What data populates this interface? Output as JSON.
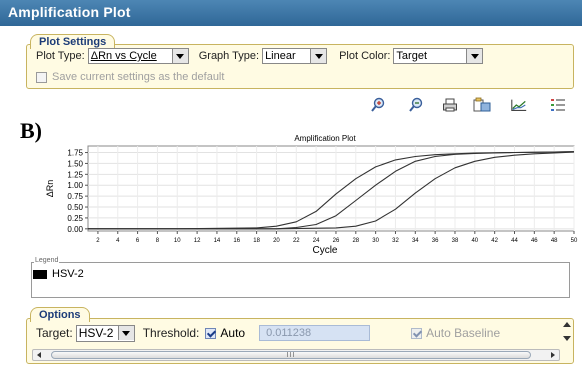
{
  "window": {
    "title": "Amplification Plot"
  },
  "plot_settings": {
    "title": "Plot Settings",
    "plot_type_label": "Plot Type:",
    "plot_type_value": "ΔRn vs Cycle",
    "graph_type_label": "Graph Type:",
    "graph_type_value": "Linear",
    "plot_color_label": "Plot Color:",
    "plot_color_value": "Target",
    "save_default_label": "Save current settings as the default"
  },
  "toolbar": {
    "icons": [
      "zoom-in-icon",
      "zoom-out-icon",
      "print-icon",
      "export-icon",
      "graph-icon",
      "legend-list-icon"
    ]
  },
  "panel_letter": "B)",
  "chart_data": {
    "type": "line",
    "title": "Amplification Plot",
    "xlabel": "Cycle",
    "ylabel": "ΔRn",
    "xlim": [
      1,
      50
    ],
    "ylim": [
      -0.05,
      1.9
    ],
    "xticks": [
      "2",
      "4",
      "6",
      "8",
      "10",
      "12",
      "14",
      "16",
      "18",
      "20",
      "22",
      "24",
      "26",
      "28",
      "30",
      "32",
      "34",
      "36",
      "38",
      "40",
      "42",
      "44",
      "46",
      "48",
      "50"
    ],
    "yticks": [
      "0.00",
      "0.25",
      "0.50",
      "0.75",
      "1.00",
      "1.25",
      "1.50",
      "1.75"
    ],
    "grid": true,
    "series_color": "#333333",
    "series": [
      {
        "x": [
          1,
          10,
          18,
          20,
          22,
          24,
          26,
          28,
          30,
          32,
          34,
          36,
          38,
          40,
          44,
          48,
          50
        ],
        "y": [
          0.0,
          0.0,
          0.02,
          0.06,
          0.16,
          0.4,
          0.8,
          1.15,
          1.42,
          1.58,
          1.66,
          1.7,
          1.72,
          1.74,
          1.75,
          1.76,
          1.77
        ]
      },
      {
        "x": [
          1,
          10,
          20,
          22,
          24,
          26,
          28,
          30,
          32,
          34,
          36,
          38,
          40,
          44,
          48,
          50
        ],
        "y": [
          0.0,
          0.0,
          0.0,
          0.03,
          0.1,
          0.3,
          0.65,
          1.0,
          1.32,
          1.55,
          1.66,
          1.71,
          1.73,
          1.75,
          1.76,
          1.77
        ]
      },
      {
        "x": [
          1,
          10,
          20,
          26,
          28,
          30,
          32,
          34,
          36,
          38,
          40,
          42,
          44,
          46,
          48,
          50
        ],
        "y": [
          0.0,
          0.0,
          0.0,
          0.02,
          0.06,
          0.18,
          0.45,
          0.82,
          1.15,
          1.4,
          1.55,
          1.64,
          1.69,
          1.72,
          1.74,
          1.76
        ]
      }
    ]
  },
  "legend": {
    "title": "Legend",
    "entry": "HSV-2",
    "swatch_color": "#000000"
  },
  "options": {
    "title": "Options",
    "target_label": "Target:",
    "target_value": "HSV-2",
    "threshold_label": "Threshold:",
    "auto_label": "Auto",
    "threshold_value": "0.011238",
    "auto_baseline_label": "Auto Baseline",
    "scroll_thumb_text": "III"
  }
}
